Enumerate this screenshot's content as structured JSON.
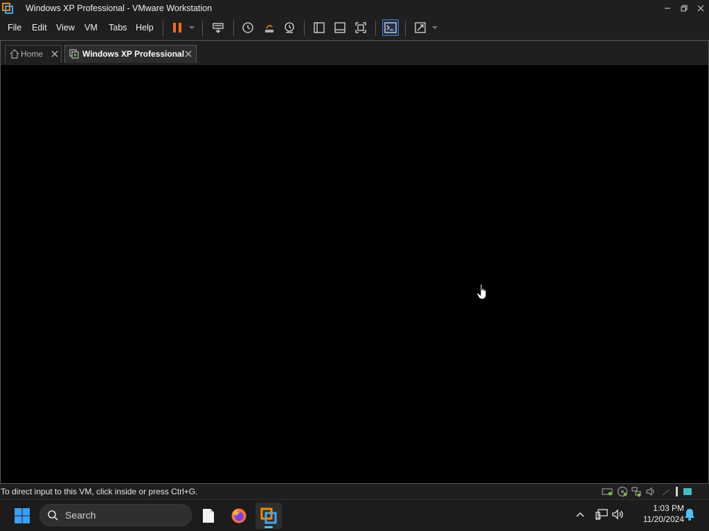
{
  "window": {
    "title": "Windows XP Professional - VMware Workstation",
    "app_icon": "vmware-logo-icon",
    "controls": [
      "minimize-icon",
      "restore-icon",
      "close-icon"
    ]
  },
  "menu": {
    "file": "File",
    "edit": "Edit",
    "view": "View",
    "vm": "VM",
    "tabs": "Tabs",
    "help": "Help"
  },
  "toolbar": {
    "icons": [
      "pause-icon",
      "dropdown-icon",
      "send-ctrl-alt-del-icon",
      "snapshot-take-icon",
      "snapshot-revert-icon",
      "snapshot-manager-icon",
      "show-library-icon",
      "thumbnail-bar-icon",
      "full-screen-icon",
      "console-view-icon",
      "stretch-guest-icon",
      "dropdown-icon"
    ]
  },
  "tabs": [
    {
      "label": "Home",
      "icon": "home-icon",
      "active": false
    },
    {
      "label": "Windows XP Professional",
      "icon": "vm-icon",
      "active": true
    }
  ],
  "status": {
    "message": "To direct input to this VM, click inside or press Ctrl+G.",
    "device_icons": [
      "hard-disk-icon",
      "cd-dvd-icon",
      "network-adapter-icon",
      "sound-card-icon",
      "display-icon",
      "message-log-icon"
    ]
  },
  "taskbar": {
    "search_placeholder": "Search",
    "apps": [
      "windows-start-icon",
      "file-explorer-icon",
      "firefox-icon",
      "vmware-workstation-icon"
    ],
    "tray": [
      "show-hidden-icons-icon",
      "network-icon",
      "volume-icon",
      "notifications-bell-icon"
    ],
    "time": "1:03 PM",
    "date": "11/20/2024"
  },
  "colors": {
    "chrome_bg": "#1f1f1f",
    "vm_bg": "#000000",
    "pause_orange": "#f26b21",
    "accent_blue": "#4cc2ff",
    "vmware_orange": "#f38b00"
  }
}
